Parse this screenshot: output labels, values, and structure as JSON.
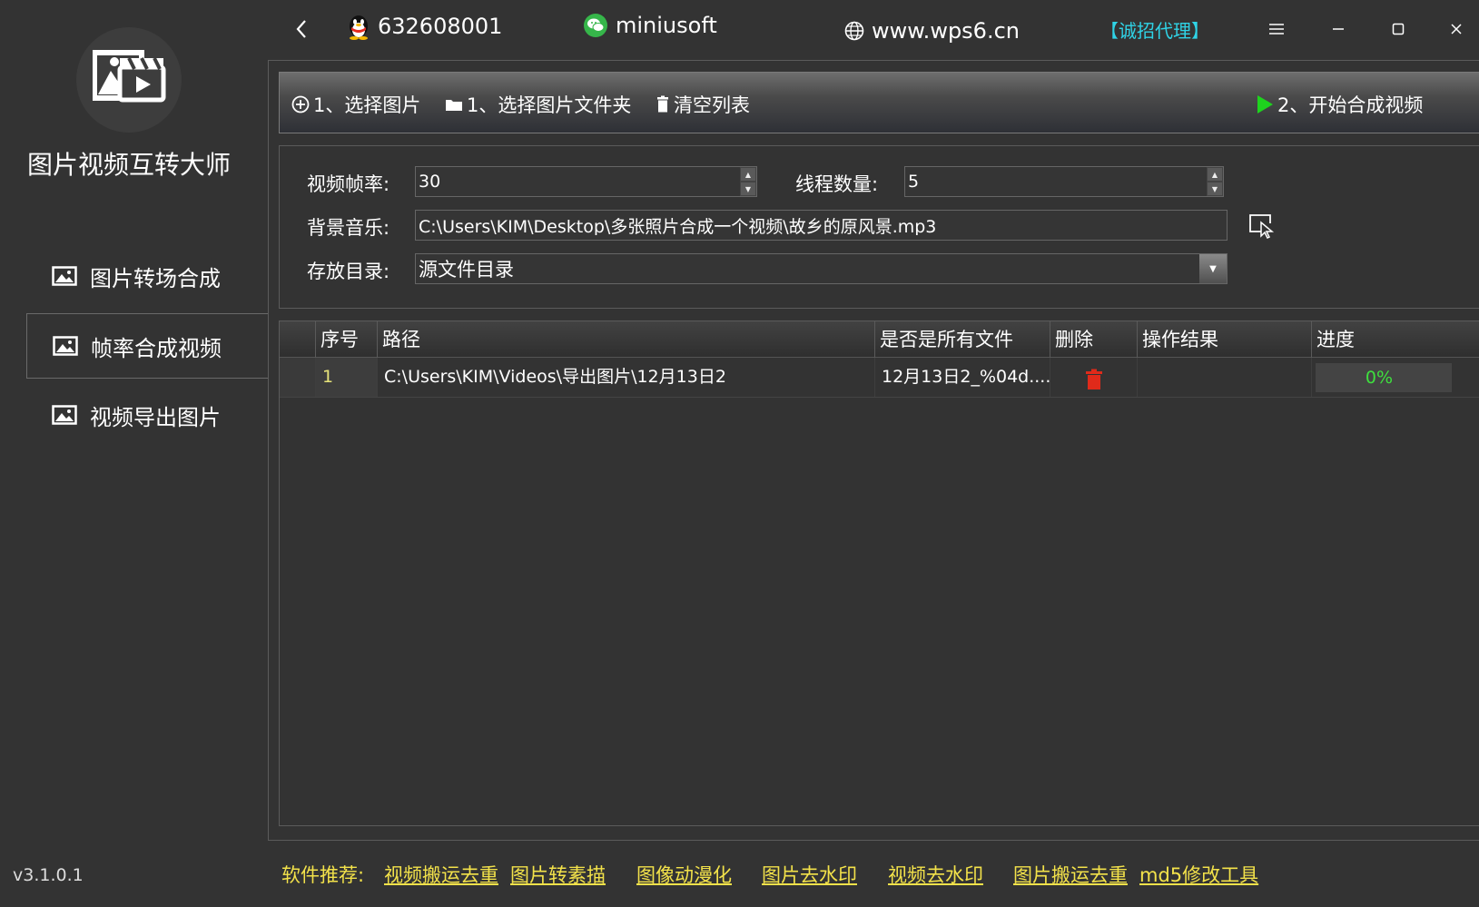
{
  "app": {
    "title": "图片视频互转大师",
    "version": "v3.1.0.1"
  },
  "sidebar": {
    "items": [
      {
        "label": "图片转场合成",
        "icon": "image-icon",
        "active": false
      },
      {
        "label": "帧率合成视频",
        "icon": "image-icon",
        "active": true
      },
      {
        "label": "视频导出图片",
        "icon": "image-icon",
        "active": false
      }
    ]
  },
  "topbar": {
    "qq": "632608001",
    "wechat": "miniusoft",
    "website": "www.wps6.cn",
    "agent": "【诚招代理】"
  },
  "toolbar": {
    "select_images": "1、选择图片",
    "select_folder": "1、选择图片文件夹",
    "clear_list": "清空列表",
    "start": "2、开始合成视频"
  },
  "settings": {
    "fps_label": "视频帧率:",
    "fps_value": "30",
    "threads_label": "线程数量:",
    "threads_value": "5",
    "music_label": "背景音乐:",
    "music_value": "C:\\Users\\KIM\\Desktop\\多张照片合成一个视频\\故乡的原风景.mp3",
    "output_label": "存放目录:",
    "output_value": "源文件目录"
  },
  "table": {
    "headers": [
      "序号",
      "路径",
      "是否是所有文件",
      "删除",
      "操作结果",
      "进度"
    ],
    "rows": [
      {
        "index": "1",
        "path": "C:\\Users\\KIM\\Videos\\导出图片\\12月13日2",
        "all_files": "12月13日2_%04d....",
        "result": "",
        "progress_text": "0%",
        "progress": 0
      }
    ]
  },
  "footer": {
    "label": "软件推荐:",
    "links": [
      "视频搬运去重",
      "图片转素描",
      "图像动漫化",
      "图片去水印",
      "视频去水印",
      "图片搬运去重",
      "md5修改工具"
    ]
  },
  "colors": {
    "background": "#333333",
    "accent_green": "#1ed31e",
    "link_yellow": "#f3e24a",
    "agent_cyan": "#2fd3e6",
    "delete_red": "#e02a1a"
  }
}
